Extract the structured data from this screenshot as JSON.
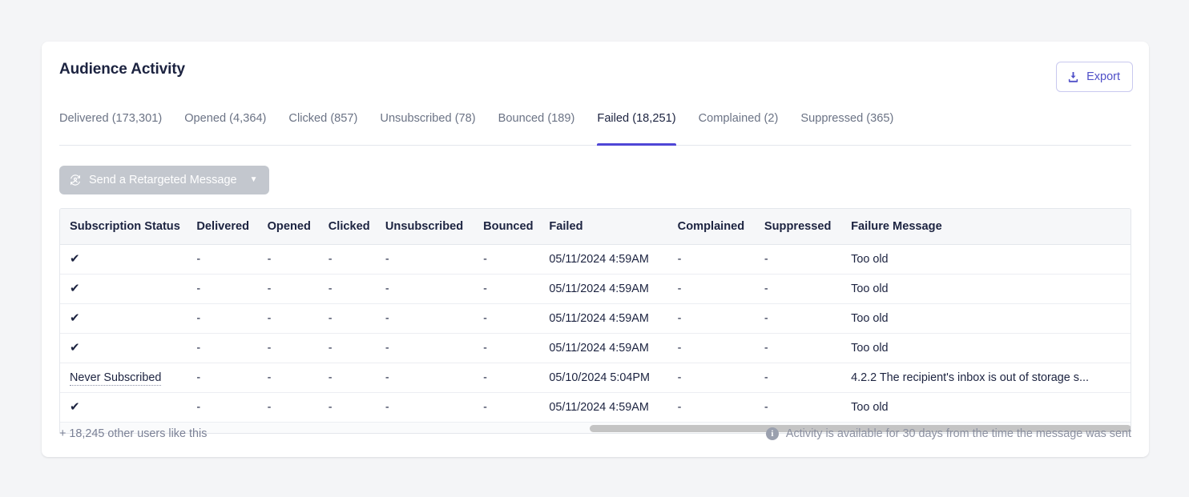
{
  "header": {
    "title": "Audience Activity",
    "export_label": "Export",
    "export_icon": "download-icon",
    "accent_color": "#4f46d6",
    "export_text_color": "#5050c8"
  },
  "tabs": [
    {
      "label": "Delivered (173,301)",
      "name": "delivered",
      "active": false
    },
    {
      "label": "Opened (4,364)",
      "name": "opened",
      "active": false
    },
    {
      "label": "Clicked (857)",
      "name": "clicked",
      "active": false
    },
    {
      "label": "Unsubscribed (78)",
      "name": "unsubscribed",
      "active": false
    },
    {
      "label": "Bounced (189)",
      "name": "bounced",
      "active": false
    },
    {
      "label": "Failed (18,251)",
      "name": "failed",
      "active": true
    },
    {
      "label": "Complained (2)",
      "name": "complained",
      "active": false
    },
    {
      "label": "Suppressed (365)",
      "name": "suppressed",
      "active": false
    }
  ],
  "toolbar": {
    "retarget_label": "Send a Retargeted Message",
    "retarget_icon": "retarget-user-icon",
    "caret": "▼",
    "disabled": true
  },
  "table": {
    "columns": [
      "Subscription Status",
      "Delivered",
      "Opened",
      "Clicked",
      "Unsubscribed",
      "Bounced",
      "Failed",
      "Complained",
      "Suppressed",
      "Failure Message"
    ],
    "rows": [
      {
        "subscription_status": "✔",
        "status_type": "check",
        "delivered": "-",
        "opened": "-",
        "clicked": "-",
        "unsubscribed": "-",
        "bounced": "-",
        "failed": "05/11/2024 4:59AM",
        "complained": "-",
        "suppressed": "-",
        "failure_message": "Too old"
      },
      {
        "subscription_status": "✔",
        "status_type": "check",
        "delivered": "-",
        "opened": "-",
        "clicked": "-",
        "unsubscribed": "-",
        "bounced": "-",
        "failed": "05/11/2024 4:59AM",
        "complained": "-",
        "suppressed": "-",
        "failure_message": "Too old"
      },
      {
        "subscription_status": "✔",
        "status_type": "check",
        "delivered": "-",
        "opened": "-",
        "clicked": "-",
        "unsubscribed": "-",
        "bounced": "-",
        "failed": "05/11/2024 4:59AM",
        "complained": "-",
        "suppressed": "-",
        "failure_message": "Too old"
      },
      {
        "subscription_status": "✔",
        "status_type": "check",
        "delivered": "-",
        "opened": "-",
        "clicked": "-",
        "unsubscribed": "-",
        "bounced": "-",
        "failed": "05/11/2024 4:59AM",
        "complained": "-",
        "suppressed": "-",
        "failure_message": "Too old"
      },
      {
        "subscription_status": "Never Subscribed",
        "status_type": "text",
        "delivered": "-",
        "opened": "-",
        "clicked": "-",
        "unsubscribed": "-",
        "bounced": "-",
        "failed": "05/10/2024 5:04PM",
        "complained": "-",
        "suppressed": "-",
        "failure_message": "4.2.2 The recipient's inbox is out of storage s..."
      },
      {
        "subscription_status": "✔",
        "status_type": "check",
        "delivered": "-",
        "opened": "-",
        "clicked": "-",
        "unsubscribed": "-",
        "bounced": "-",
        "failed": "05/11/2024 4:59AM",
        "complained": "-",
        "suppressed": "-",
        "failure_message": "Too old"
      }
    ]
  },
  "footer": {
    "more_users": "+ 18,245 other users like this",
    "availability": "Activity is available for 30 days from the time the message was sent",
    "info_icon": "info-icon",
    "info_glyph": "i"
  }
}
